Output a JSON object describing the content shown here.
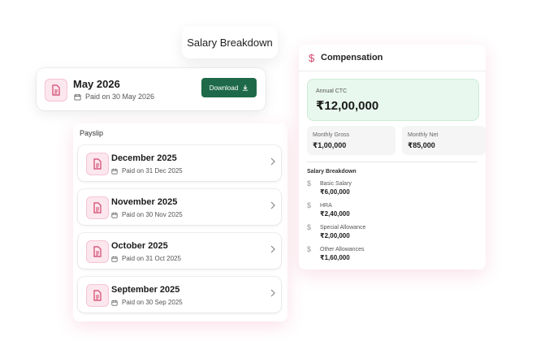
{
  "header": {
    "title": "Salary Breakdown"
  },
  "latest": {
    "month": "May 2026",
    "paid": "Paid on 30 May 2026",
    "download_label": "Download"
  },
  "payslip": {
    "title": "Payslip",
    "items": [
      {
        "month": "December 2025",
        "paid": "Paid on 31 Dec 2025"
      },
      {
        "month": "November 2025",
        "paid": "Paid on 30 Nov 2025"
      },
      {
        "month": "October 2025",
        "paid": "Paid on 31 Oct 2025"
      },
      {
        "month": "September 2025",
        "paid": "Paid on 30 Sep 2025"
      }
    ]
  },
  "compensation": {
    "title": "Compensation",
    "icon": "dollar-icon",
    "ctc_label": "Annual CTC",
    "ctc_value": "₹12,00,000",
    "monthly_gross_label": "Monthly Gross",
    "monthly_gross_value": "₹1,00,000",
    "monthly_net_label": "Monthly Net",
    "monthly_net_value": "₹85,000",
    "breakdown_title": "Salary Breakdown",
    "breakdown": [
      {
        "label": "Basic Salary",
        "value": "₹6,00,000"
      },
      {
        "label": "HRA",
        "value": "₹2,40,000"
      },
      {
        "label": "Special Allowance",
        "value": "₹2,00,000"
      },
      {
        "label": "Other Allowances",
        "value": "₹1,60,000"
      }
    ]
  },
  "colors": {
    "accent_pink": "#d0436a",
    "download_green": "#1e6a48",
    "ctc_bg": "#e8f8ee"
  }
}
